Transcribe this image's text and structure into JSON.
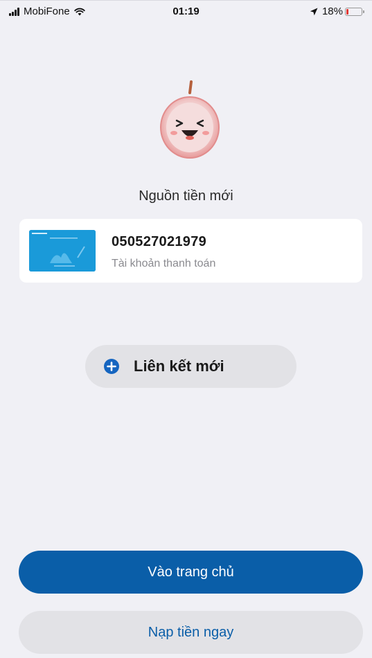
{
  "status_bar": {
    "carrier": "MobiFone",
    "time": "01:19",
    "battery": "18%"
  },
  "title": "Nguồn tiền mới",
  "source": {
    "account_number": "050527021979",
    "account_type": "Tài khoản thanh toán"
  },
  "link_new": {
    "label": "Liên kết mới",
    "icon": "plus-circle-icon"
  },
  "buttons": {
    "home": "Vào trang chủ",
    "topup": "Nạp tiền ngay"
  },
  "colors": {
    "primary": "#0a5ea8",
    "background": "#f0f0f5",
    "secondary_button": "#e2e2e6",
    "battery_low": "#e53935"
  }
}
